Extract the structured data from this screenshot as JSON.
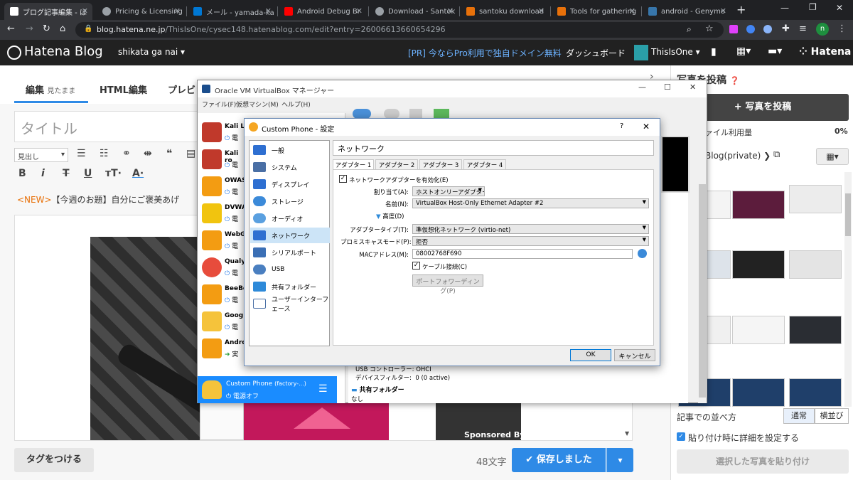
{
  "browser": {
    "tabs": [
      {
        "title": "ブログ記事編集 - は",
        "color": "#ffffff"
      },
      {
        "title": "Pricing & Licensing",
        "color": "#9aa0a6"
      },
      {
        "title": "メール - yamada-ka",
        "color": "#0078d4"
      },
      {
        "title": "Android Debug Br",
        "color": "#ff0000"
      },
      {
        "title": "Download - Santok",
        "color": "#9aa0a6"
      },
      {
        "title": "santoku download",
        "color": "#e8710a"
      },
      {
        "title": "Tools for gathering",
        "color": "#e8710a"
      },
      {
        "title": "android - Genymo",
        "color": "#3776ab"
      }
    ],
    "url_host": "blog.hatena.ne.jp",
    "url_path": "/ThisIsOne/cysec148.hatenablog.com/edit?entry=26006613660654296",
    "profile_initial": "n"
  },
  "hatena": {
    "logo": "Hatena Blog",
    "blog_name": "shikata ga nai",
    "promo": "[PR] 今ならPro利用で独自ドメイン無料",
    "dashboard": "ダッシュボード",
    "user": "ThisIsOne",
    "brand": "Hatena"
  },
  "editor": {
    "tabs": [
      {
        "label": "編集",
        "sub": "見たまま"
      },
      {
        "label": "HTML編集",
        "sub": ""
      },
      {
        "label": "プレビ",
        "sub": ""
      }
    ],
    "title_placeholder": "タイトル",
    "heading_select": "見出し",
    "notice_tag": "<NEW>",
    "notice_text": "【今週のお題】自分にご褒美あげ",
    "tag_button": "タグをつける",
    "char_count": "48文字",
    "save_button": "✔ 保存しました",
    "sponsored": "Sponsored By"
  },
  "right": {
    "heading": "写真を投稿",
    "upload_button": "+ 写真を投稿",
    "usage_label": "ァイル利用量",
    "usage_value": "0%",
    "album_select": "Blog(private)",
    "order_label": "記事での並べ方",
    "order_normal": "通常",
    "order_horizontal": "横並び",
    "detail_checkbox": "貼り付け時に詳細を設定する",
    "paste_button": "選択した写真を貼り付け"
  },
  "vbox": {
    "title": "Oracle VM VirtualBox マネージャー",
    "menu": [
      "ファイル(F)",
      "仮想マシン(M)",
      "ヘルプ(H)"
    ],
    "vms": [
      {
        "name": "Kali Li",
        "state": "電",
        "color": "#c0392b"
      },
      {
        "name": "Kali ro",
        "state": "電",
        "color": "#c0392b"
      },
      {
        "name": "OWAS",
        "state": "電",
        "color": "#f39c12"
      },
      {
        "name": "DVWA",
        "state": "電",
        "color": "#f1c40f"
      },
      {
        "name": "WebG",
        "state": "電",
        "color": "#f39c12"
      },
      {
        "name": "Qualys",
        "state": "電",
        "color": "#e74c3c"
      },
      {
        "name": "BeeBo",
        "state": "電",
        "color": "#f39c12"
      },
      {
        "name": "Google",
        "state": "電",
        "color": "#f5c33b"
      },
      {
        "name": "Androi",
        "state": "実",
        "color": "#f39c12"
      }
    ],
    "selected_vm_name": "Custom Phone",
    "selected_vm_sub": "(factory-...)",
    "selected_vm_state": "電源オフ",
    "usb_controller": "USB コントローラー:",
    "usb_controller_val": "OHCI",
    "device_filter": "デバイスフィルター:",
    "device_filter_val": "0 (0 active)",
    "shared_folder": "共有フォルダー",
    "none": "なし"
  },
  "dialog": {
    "title": "Custom Phone - 設定",
    "help": "?",
    "categories": [
      {
        "label": "一般",
        "color": "#2e6fd1"
      },
      {
        "label": "システム",
        "color": "#4a6fa5"
      },
      {
        "label": "ディスプレイ",
        "color": "#2e6fd1"
      },
      {
        "label": "ストレージ",
        "color": "#3b8ad9"
      },
      {
        "label": "オーディオ",
        "color": "#5aa0e0"
      },
      {
        "label": "ネットワーク",
        "color": "#2e6fd1"
      },
      {
        "label": "シリアルポート",
        "color": "#3b6fb5"
      },
      {
        "label": "USB",
        "color": "#4a7fc0"
      },
      {
        "label": "共有フォルダー",
        "color": "#2e8ad9"
      },
      {
        "label": "ユーザーインターフェース",
        "color": "#4a6fa5"
      }
    ],
    "selected_category": 5,
    "page_title": "ネットワーク",
    "adapter_tabs": [
      "アダプター 1",
      "アダプター 2",
      "アダプター 3",
      "アダプター 4"
    ],
    "enable_label": "ネットワークアダプターを有効化(E)",
    "attach_label": "割り当て(A):",
    "attach_value": "ホストオンリーアダプター",
    "name_label": "名前(N):",
    "name_value": "VirtualBox Host-Only Ethernet Adapter #2",
    "advanced_label": "高度(D)",
    "adapter_type_label": "アダプタータイプ(T):",
    "adapter_type_value": "準仮想化ネットワーク (virtio-net)",
    "promisc_label": "プロミスキャスモード(P):",
    "promisc_value": "拒否",
    "mac_label": "MACアドレス(M):",
    "mac_value": "08002768F690",
    "cable_label": "ケーブル接続(C)",
    "port_forward": "ポートフォワーディング(P)",
    "ok": "OK",
    "cancel": "キャンセル"
  }
}
